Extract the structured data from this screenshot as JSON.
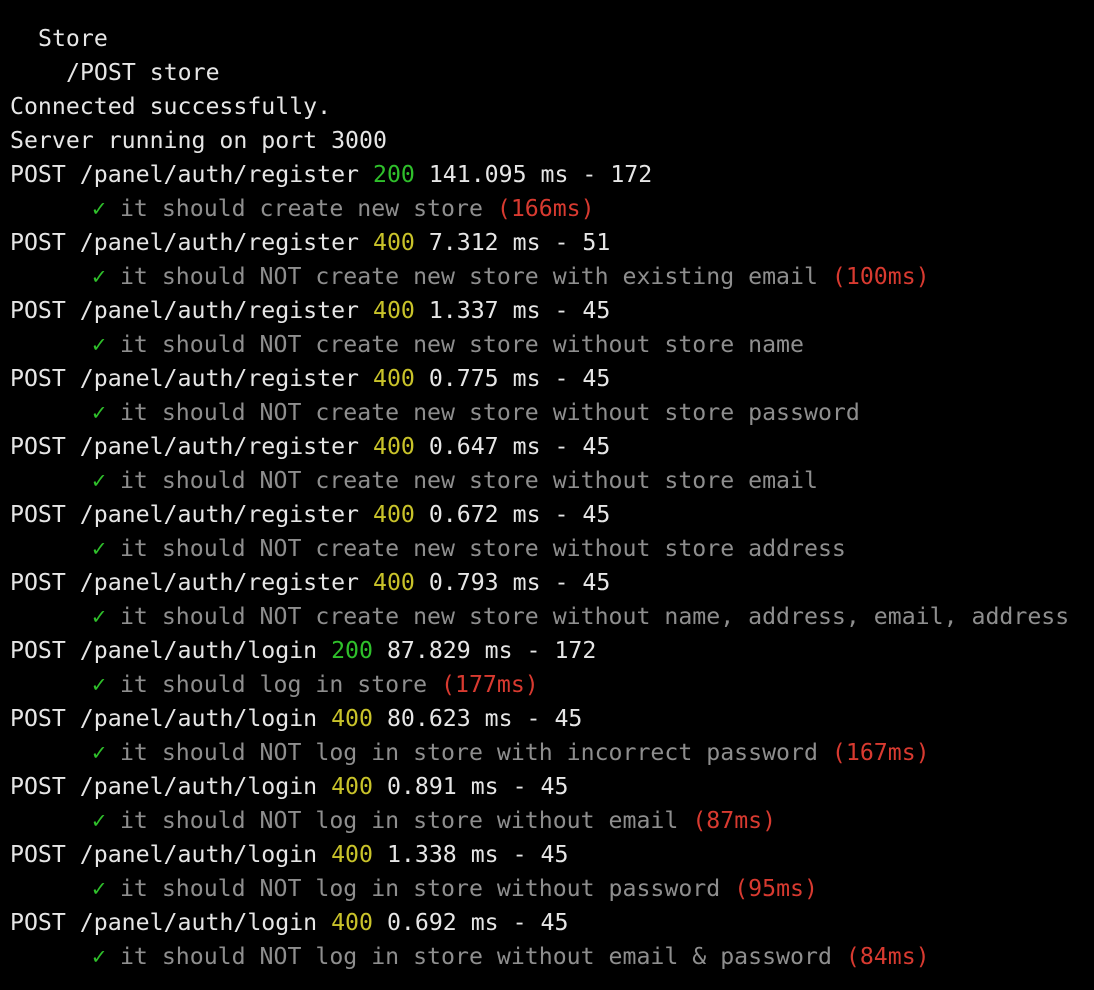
{
  "terminal": {
    "suite_title": "Store",
    "suite_subtitle": "/POST store",
    "connected_msg": "Connected successfully.",
    "server_msg": "Server running on port 3000",
    "check_glyph": "✓",
    "colors": {
      "background": "#000000",
      "text": "#e6e6e6",
      "status_200": "#2fc02b",
      "status_400": "#c9c32a",
      "check": "#2fc02b",
      "test_text": "#8e8e8e",
      "duration": "#d83a30"
    },
    "entries": [
      {
        "request": {
          "method_path": "POST /panel/auth/register",
          "status": "200",
          "metrics": "141.095 ms - 172"
        },
        "test": {
          "text": "it should create new store",
          "duration": "(166ms)"
        }
      },
      {
        "request": {
          "method_path": "POST /panel/auth/register",
          "status": "400",
          "metrics": "7.312 ms - 51"
        },
        "test": {
          "text": "it should NOT create new store with existing email",
          "duration": "(100ms)"
        }
      },
      {
        "request": {
          "method_path": "POST /panel/auth/register",
          "status": "400",
          "metrics": "1.337 ms - 45"
        },
        "test": {
          "text": "it should NOT create new store without store name",
          "duration": ""
        }
      },
      {
        "request": {
          "method_path": "POST /panel/auth/register",
          "status": "400",
          "metrics": "0.775 ms - 45"
        },
        "test": {
          "text": "it should NOT create new store without store password",
          "duration": ""
        }
      },
      {
        "request": {
          "method_path": "POST /panel/auth/register",
          "status": "400",
          "metrics": "0.647 ms - 45"
        },
        "test": {
          "text": "it should NOT create new store without store email",
          "duration": ""
        }
      },
      {
        "request": {
          "method_path": "POST /panel/auth/register",
          "status": "400",
          "metrics": "0.672 ms - 45"
        },
        "test": {
          "text": "it should NOT create new store without store address",
          "duration": ""
        }
      },
      {
        "request": {
          "method_path": "POST /panel/auth/register",
          "status": "400",
          "metrics": "0.793 ms - 45"
        },
        "test": {
          "text": "it should NOT create new store without name, address, email, address",
          "duration": ""
        }
      },
      {
        "request": {
          "method_path": "POST /panel/auth/login",
          "status": "200",
          "metrics": "87.829 ms - 172"
        },
        "test": {
          "text": "it should log in store",
          "duration": "(177ms)"
        }
      },
      {
        "request": {
          "method_path": "POST /panel/auth/login",
          "status": "400",
          "metrics": "80.623 ms - 45"
        },
        "test": {
          "text": "it should NOT log in store with incorrect password",
          "duration": "(167ms)"
        }
      },
      {
        "request": {
          "method_path": "POST /panel/auth/login",
          "status": "400",
          "metrics": "0.891 ms - 45"
        },
        "test": {
          "text": "it should NOT log in store without email",
          "duration": "(87ms)"
        }
      },
      {
        "request": {
          "method_path": "POST /panel/auth/login",
          "status": "400",
          "metrics": "1.338 ms - 45"
        },
        "test": {
          "text": "it should NOT log in store without password",
          "duration": "(95ms)"
        }
      },
      {
        "request": {
          "method_path": "POST /panel/auth/login",
          "status": "400",
          "metrics": "0.692 ms - 45"
        },
        "test": {
          "text": "it should NOT log in store without email & password",
          "duration": "(84ms)"
        }
      }
    ]
  }
}
